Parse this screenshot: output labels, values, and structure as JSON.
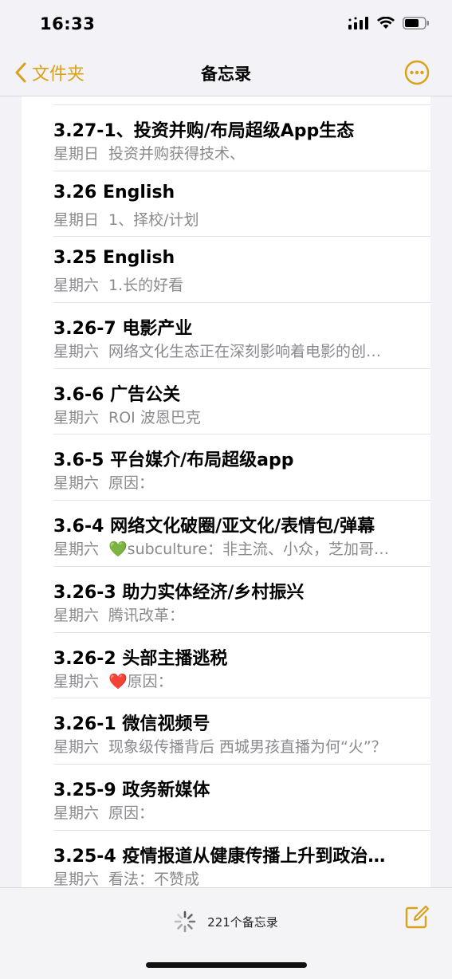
{
  "status_bar": {
    "time": "16:33"
  },
  "nav": {
    "back_label": "文件夹",
    "title": "备忘录",
    "accent_color": "#d9a21b"
  },
  "notes": [
    {
      "title": "3.27-1、投资并购/布局超级App生态",
      "day": "星期日",
      "preview": "投资并购获得技术、"
    },
    {
      "title": "3.26 English",
      "day": "星期日",
      "preview": "1、择校/计划"
    },
    {
      "title": "3.25 English",
      "day": "星期六",
      "preview": "1.长的好看"
    },
    {
      "title": "3.26-7 电影产业",
      "day": "星期六",
      "preview": "网络文化生态正在深刻影响着电影的创…"
    },
    {
      "title": "3.6-6 广告公关",
      "day": "星期六",
      "preview": "ROI 波恩巴克"
    },
    {
      "title": "3.6-5 平台媒介/布局超级app",
      "day": "星期六",
      "preview": "原因："
    },
    {
      "title": "3.6-4 网络文化破圈/亚文化/表情包/弹幕",
      "day": "星期六",
      "preview": "💚subculture：非主流、小众，芝加哥…"
    },
    {
      "title": "3.26-3 助力实体经济/乡村振兴",
      "day": "星期六",
      "preview": "腾讯改革："
    },
    {
      "title": "3.26-2 头部主播逃税",
      "day": "星期六",
      "preview": "❤️原因："
    },
    {
      "title": "3.26-1 微信视频号",
      "day": "星期六",
      "preview": "现象级传播背后 西城男孩直播为何“火”？"
    },
    {
      "title": "3.25-9 政务新媒体",
      "day": "星期六",
      "preview": "原因："
    },
    {
      "title": "3.25-4 疫情报道从健康传播上升到政治…",
      "day": "星期六",
      "preview": "看法：不赞成"
    }
  ],
  "toolbar": {
    "count_label": "221个备忘录",
    "icons": [
      "loading-spinner-icon",
      "compose-icon"
    ]
  }
}
